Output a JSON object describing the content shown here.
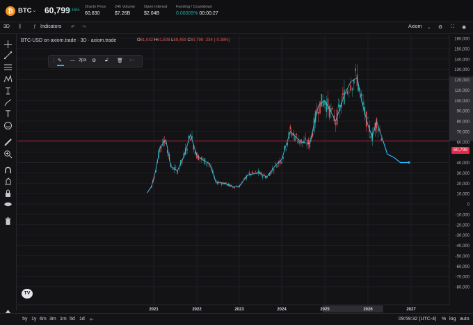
{
  "header": {
    "symbol": "BTC",
    "price": "60,799",
    "change": "+0.16%",
    "stats": [
      {
        "label": "Oracle Price",
        "value": "60,830"
      },
      {
        "label": "24h Volume",
        "value": "$7.26B"
      },
      {
        "label": "Open Interest",
        "value": "$2.04B"
      },
      {
        "label": "Funding / Countdown",
        "value_green": "0.00009%",
        "value": "00:00:27"
      }
    ]
  },
  "toolbar": {
    "interval": "3D",
    "indicators_label": "Indicators",
    "source_label": "Axiom"
  },
  "legend": {
    "title": "BTC-USD on axiom.trade · 3D · axiom.trade",
    "o_label": "O",
    "o_value": "61,032",
    "h_label": "H",
    "h_value": "61,508",
    "l_label": "L",
    "l_value": "59,459",
    "c_label": "C",
    "c_value": "60,799",
    "chg": "-234 (-0.38%)"
  },
  "float_toolbar": {
    "width_label": "2px"
  },
  "price_badge": "60,799",
  "bottom": {
    "ranges": [
      "5y",
      "1y",
      "6m",
      "3m",
      "1m",
      "5d",
      "1d"
    ],
    "time": "09:59:32 (UTC-4)",
    "pct": "%",
    "log": "log",
    "auto": "auto"
  },
  "chart_data": {
    "type": "candlestick",
    "y_ticks": [
      "160,000",
      "150,000",
      "140,000",
      "130,000",
      "120,000",
      "110,000",
      "100,000",
      "90,000",
      "80,000",
      "70,000",
      "60,000",
      "50,000",
      "40,000",
      "30,000",
      "20,000",
      "10,000",
      "0",
      "-10,000",
      "-20,000",
      "-30,000",
      "-40,000",
      "-50,000",
      "-60,000",
      "-70,000",
      "-80,000"
    ],
    "x_ticks": [
      "2021",
      "2022",
      "2023",
      "2024",
      "2025",
      "2026",
      "2027"
    ],
    "ylim": [
      -80000,
      160000
    ],
    "last_price": 60799,
    "series": [
      {
        "x": 2020.85,
        "y": 11000
      },
      {
        "x": 2020.95,
        "y": 17000
      },
      {
        "x": 2021.05,
        "y": 33000
      },
      {
        "x": 2021.15,
        "y": 55000
      },
      {
        "x": 2021.28,
        "y": 62000
      },
      {
        "x": 2021.4,
        "y": 36000
      },
      {
        "x": 2021.55,
        "y": 32000
      },
      {
        "x": 2021.7,
        "y": 46000
      },
      {
        "x": 2021.85,
        "y": 67000
      },
      {
        "x": 2022.0,
        "y": 47000
      },
      {
        "x": 2022.15,
        "y": 42000
      },
      {
        "x": 2022.3,
        "y": 39000
      },
      {
        "x": 2022.45,
        "y": 21000
      },
      {
        "x": 2022.65,
        "y": 20000
      },
      {
        "x": 2022.85,
        "y": 16500
      },
      {
        "x": 2023.0,
        "y": 17000
      },
      {
        "x": 2023.2,
        "y": 28000
      },
      {
        "x": 2023.45,
        "y": 30000
      },
      {
        "x": 2023.65,
        "y": 26000
      },
      {
        "x": 2023.85,
        "y": 37000
      },
      {
        "x": 2024.0,
        "y": 43000
      },
      {
        "x": 2024.2,
        "y": 70000
      },
      {
        "x": 2024.45,
        "y": 60000
      },
      {
        "x": 2024.65,
        "y": 58000
      },
      {
        "x": 2024.85,
        "y": 95000
      },
      {
        "x": 2025.0,
        "y": 100000
      },
      {
        "x": 2025.25,
        "y": 80000
      },
      {
        "x": 2025.45,
        "y": 105000
      },
      {
        "x": 2025.6,
        "y": 118000
      },
      {
        "x": 2025.75,
        "y": 122000
      },
      {
        "x": 2025.85,
        "y": 100000
      },
      {
        "x": 2026.0,
        "y": 76000
      },
      {
        "x": 2026.1,
        "y": 65000
      },
      {
        "x": 2026.2,
        "y": 80000
      },
      {
        "x": 2026.35,
        "y": 61000
      }
    ],
    "projection": [
      {
        "x": 2026.35,
        "y": 61000
      },
      {
        "x": 2026.45,
        "y": 48000
      },
      {
        "x": 2026.6,
        "y": 45000
      },
      {
        "x": 2026.75,
        "y": 40000
      },
      {
        "x": 2026.95,
        "y": 40000
      }
    ]
  }
}
